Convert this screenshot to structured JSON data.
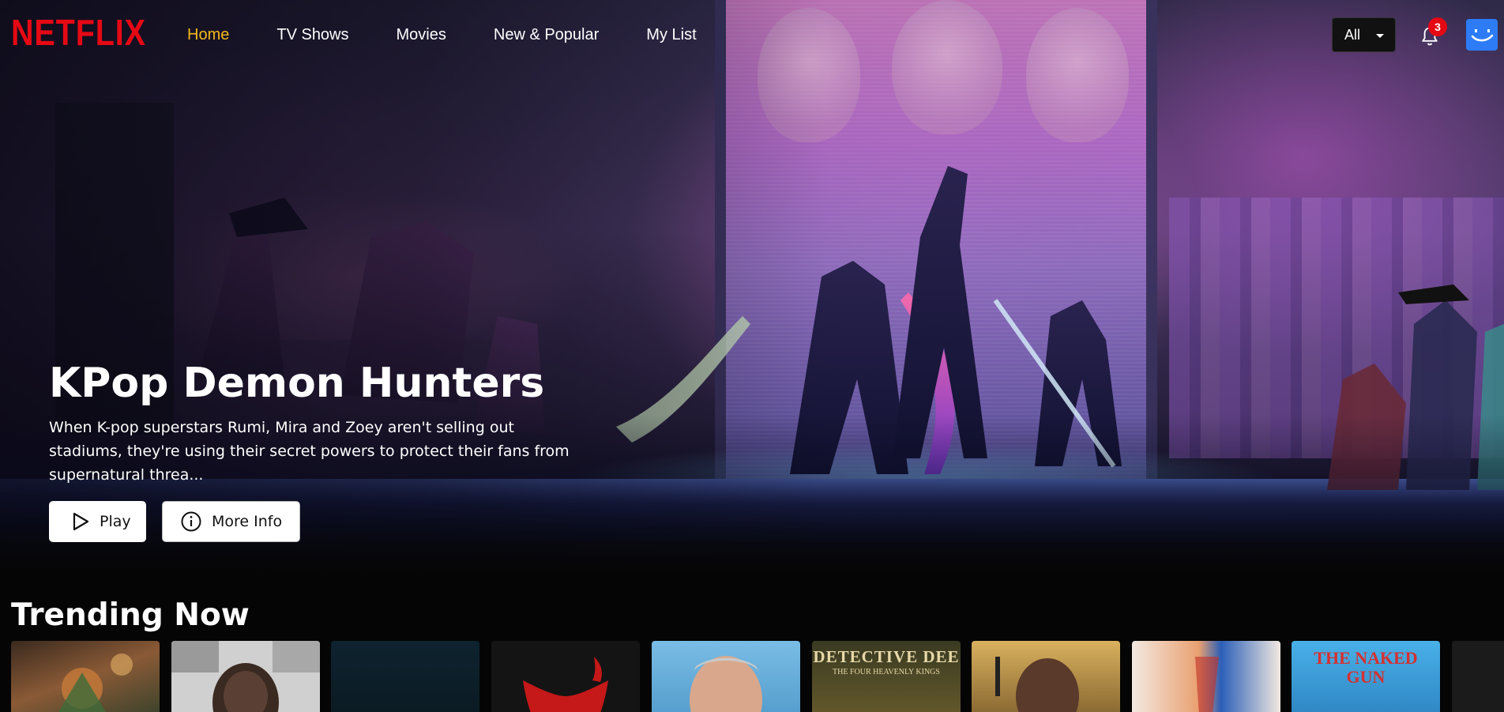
{
  "brand": {
    "logo_text": "NETFLIX",
    "logo_color": "#e50914"
  },
  "nav": {
    "items": [
      {
        "label": "Home",
        "active": true
      },
      {
        "label": "TV Shows",
        "active": false
      },
      {
        "label": "Movies",
        "active": false
      },
      {
        "label": "New & Popular",
        "active": false
      },
      {
        "label": "My List",
        "active": false
      }
    ],
    "active_color": "#f5b91c"
  },
  "header_controls": {
    "filter": {
      "selected": "All",
      "icon": "chevron-down-icon"
    },
    "notifications": {
      "icon": "bell-icon",
      "count": "3"
    },
    "profile": {
      "icon": "smiley-avatar-icon",
      "color": "#2d7cf6"
    }
  },
  "hero": {
    "title": "KPop Demon Hunters",
    "description": "When K-pop superstars Rumi, Mira and Zoey aren't selling out stadiums, they're using their secret powers to protect their fans from supernatural threa...",
    "play_label": "Play",
    "play_icon": "play-icon",
    "info_label": "More Info",
    "info_icon": "info-circle-icon"
  },
  "trending": {
    "title": "Trending Now",
    "cards": [
      {
        "name": "anime-action-poster",
        "label": "",
        "bg": "#5a3a26"
      },
      {
        "name": "documentary-portrait-poster",
        "label": "",
        "bg": "#c9c9c9"
      },
      {
        "name": "dark-ocean-poster",
        "label": "",
        "bg": "#0f2630"
      },
      {
        "name": "red-demon-poster",
        "label": "",
        "bg": "#161616"
      },
      {
        "name": "action-hero-poster",
        "label": "",
        "bg": "#6fb6e3"
      },
      {
        "name": "detective-dee-poster",
        "label": "DETECTIVE DEE",
        "sub": "THE FOUR HEAVENLY KINGS",
        "bg": "#4a4526"
      },
      {
        "name": "western-gunman-poster",
        "label": "",
        "bg": "#c9a24f"
      },
      {
        "name": "superman-poster",
        "label": "",
        "bg": "#f0e6de"
      },
      {
        "name": "the-naked-gun-poster",
        "label": "THE NAKED GUN",
        "bg": "#3aa0dc"
      },
      {
        "name": "partial-poster",
        "label": "",
        "bg": "#1b1b1b"
      }
    ]
  }
}
